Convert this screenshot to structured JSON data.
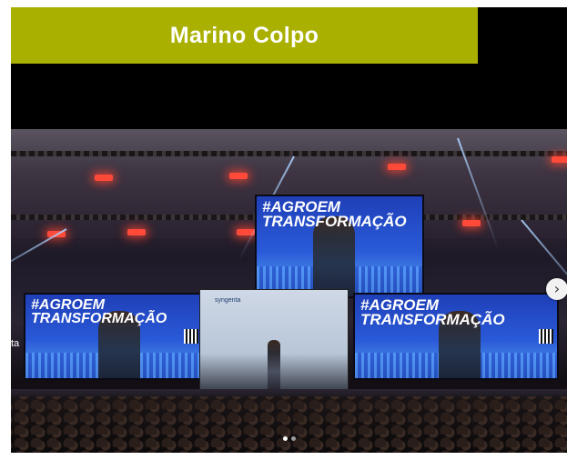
{
  "header": {
    "title": "Marino Colpo"
  },
  "photo": {
    "main_screen": {
      "line1": "#AGROEM",
      "line2": "TRANSFORMAÇÃO"
    },
    "left_screen": {
      "line1": "#AGROEM",
      "line2": "TRANSFORMAÇÃO"
    },
    "right_screen": {
      "line1": "#AGROEM",
      "line2": "TRANSFORMAÇÃO"
    },
    "center_logo": "syngenta",
    "edge_text": "ta"
  },
  "carousel": {
    "next_label": "›",
    "dot_count": 2,
    "active_index": 0
  },
  "colors": {
    "title_bar": "#aab000",
    "title_text": "#ffffff",
    "frame": "#000000"
  }
}
